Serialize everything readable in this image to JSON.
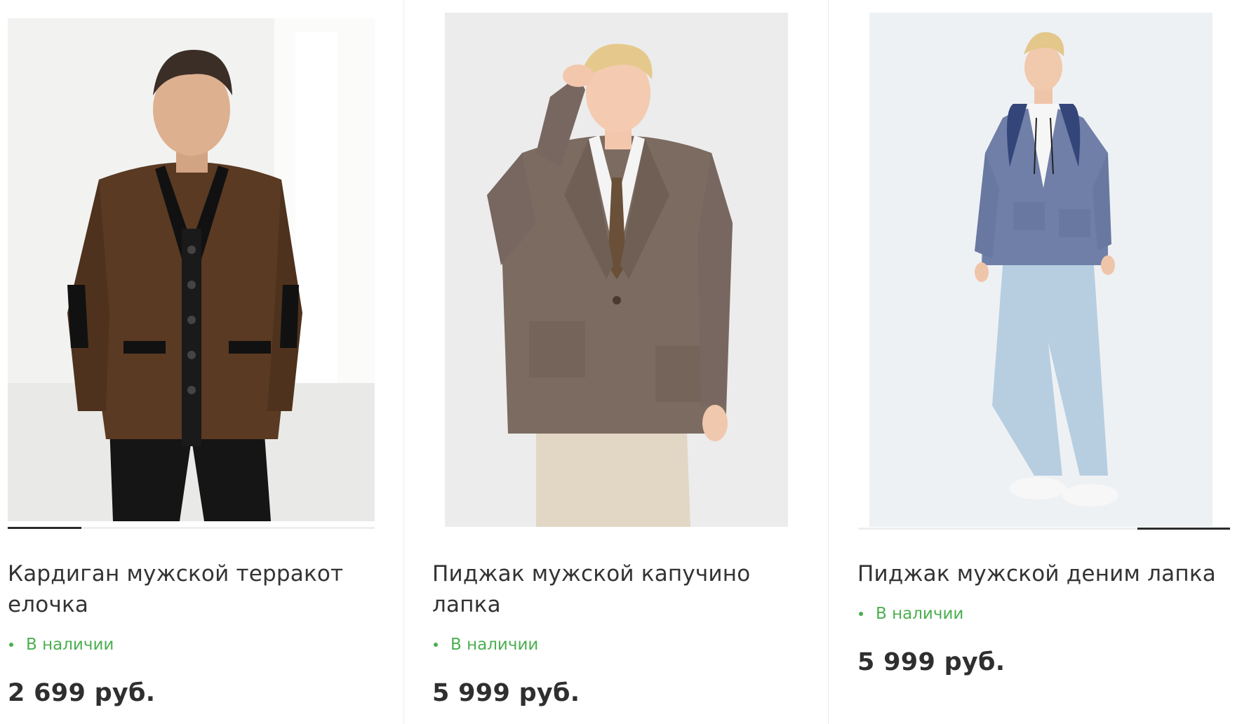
{
  "products": [
    {
      "title": "Кардиган мужской терракот елочка",
      "availability": "В наличии",
      "price": "2 699 руб.",
      "image_icon": "man-cardigan-photo",
      "slider_position": 0.0
    },
    {
      "title": "Пиджак мужской капучино лапка",
      "availability": "В наличии",
      "price": "5 999 руб.",
      "image_icon": "man-blazer-photo"
    },
    {
      "title": "Пиджак мужской деним лапка",
      "availability": "В наличии",
      "price": "5 999 руб.",
      "image_icon": "man-denim-blazer-photo",
      "slider_position": 1.0
    }
  ],
  "colors": {
    "in_stock": "#4caf50",
    "text": "#333333",
    "slider_active": "#2b2b2b"
  }
}
